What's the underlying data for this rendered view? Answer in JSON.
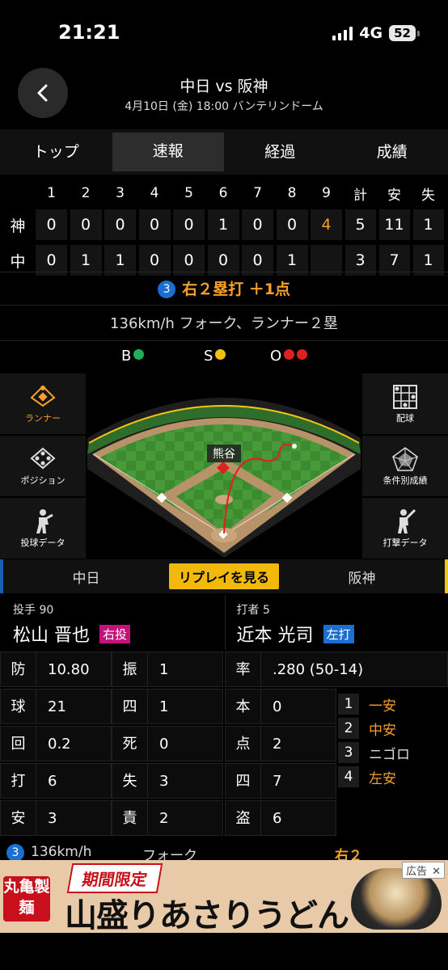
{
  "status": {
    "time": "21:21",
    "network": "4G",
    "battery": "52"
  },
  "header": {
    "title": "中日 vs 阪神",
    "subtitle": "4月10日 (金) 18:00 バンテリンドーム"
  },
  "tabs": [
    {
      "label": "トップ",
      "active": false
    },
    {
      "label": "速報",
      "active": true
    },
    {
      "label": "経過",
      "active": false
    },
    {
      "label": "成績",
      "active": false
    }
  ],
  "scoreboard": {
    "headers": [
      "1",
      "2",
      "3",
      "4",
      "5",
      "6",
      "7",
      "8",
      "9",
      "計",
      "安",
      "失"
    ],
    "rows": [
      {
        "team": "神",
        "cells": [
          "0",
          "0",
          "0",
          "0",
          "0",
          "1",
          "0",
          "0",
          "4",
          "5",
          "11",
          "1"
        ],
        "highlight_index": 8
      },
      {
        "team": "中",
        "cells": [
          "0",
          "1",
          "1",
          "0",
          "0",
          "0",
          "0",
          "1",
          "",
          "3",
          "7",
          "1"
        ],
        "highlight_index": -1
      }
    ]
  },
  "play": {
    "number": "3",
    "text": "右２塁打 ＋1点"
  },
  "pitch_info": "136km/h フォーク、ランナー２塁",
  "count": {
    "b_label": "B",
    "s_label": "S",
    "o_label": "O",
    "balls": 1,
    "strikes": 1,
    "outs": 2,
    "colors": {
      "ball": "#1fae5b",
      "strike": "#f2c012",
      "out": "#e0201c"
    }
  },
  "side_buttons": {
    "left": [
      {
        "label": "ランナー",
        "icon": "runner-diamond-icon",
        "selected": true
      },
      {
        "label": "ポジション",
        "icon": "position-icon",
        "selected": false
      },
      {
        "label": "投球データ",
        "icon": "pitcher-icon",
        "selected": false
      }
    ],
    "right": [
      {
        "label": "配球",
        "icon": "pitch-grid-icon",
        "selected": false
      },
      {
        "label": "条件別成績",
        "icon": "radar-chart-icon",
        "selected": false
      },
      {
        "label": "打撃データ",
        "icon": "batter-icon",
        "selected": false
      }
    ]
  },
  "field": {
    "fielder_label": "熊谷"
  },
  "teambar": {
    "home": "中日",
    "replay": "リプレイを見る",
    "away": "阪神"
  },
  "pitcher": {
    "role": "投手 90",
    "name": "松山 晋也",
    "hand": "右投"
  },
  "batter": {
    "role": "打者 5",
    "name": "近本 光司",
    "hand": "左打"
  },
  "pitcher_stats": [
    {
      "k": "防",
      "v": "10.80"
    },
    {
      "k": "振",
      "v": "1"
    },
    {
      "k": "球",
      "v": "21"
    },
    {
      "k": "四",
      "v": "1"
    },
    {
      "k": "回",
      "v": "0.2"
    },
    {
      "k": "死",
      "v": "0"
    },
    {
      "k": "打",
      "v": "6"
    },
    {
      "k": "失",
      "v": "3"
    },
    {
      "k": "安",
      "v": "3"
    },
    {
      "k": "責",
      "v": "2"
    }
  ],
  "batter_stats": [
    {
      "k": "率",
      "v": ".280 (50-14)"
    },
    {
      "k": "本",
      "v": "0"
    },
    {
      "k": "点",
      "v": "2"
    },
    {
      "k": "四",
      "v": "7"
    },
    {
      "k": "盗",
      "v": "6"
    }
  ],
  "at_bats": [
    {
      "n": "1",
      "result": "一安",
      "hit": true
    },
    {
      "n": "2",
      "result": "中安",
      "hit": true
    },
    {
      "n": "3",
      "result": "ニゴロ",
      "hit": false
    },
    {
      "n": "4",
      "result": "左安",
      "hit": true
    }
  ],
  "peek_row": {
    "number": "3",
    "speed": "136km/h",
    "pitch": "フォーク",
    "result": "右２"
  },
  "ad": {
    "brand": "丸亀製麺",
    "limited": "期間限定",
    "headline": "山盛りあさりうどん",
    "ad_label": "広告",
    "close": "✕"
  }
}
